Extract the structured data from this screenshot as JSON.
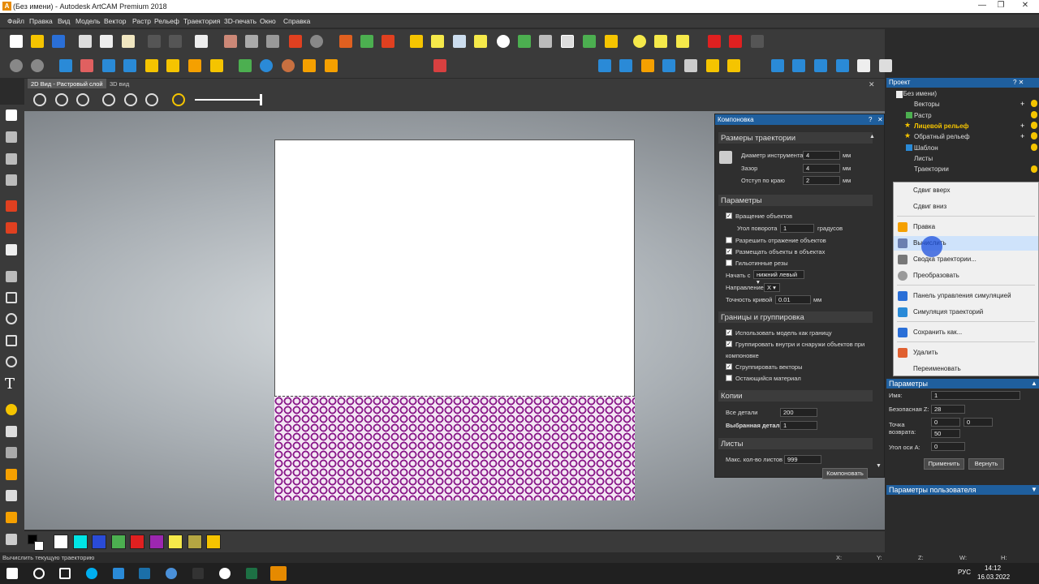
{
  "window": {
    "title": "(Без имени) - Autodesk ArtCAM Premium 2018",
    "logo": "A",
    "minimize": "—",
    "maximize": "❐",
    "close": "✕"
  },
  "menu": [
    "Файл",
    "Правка",
    "Вид",
    "Модель",
    "Вектор",
    "Растр",
    "Рельеф",
    "Траектория",
    "3D-печать",
    "Окно",
    "Справка"
  ],
  "tabs": {
    "tab2d": "2D Вид - Растровый слой",
    "tab3d": "3D вид"
  },
  "layout": {
    "title": "Компоновка",
    "help": "?",
    "close": "✕",
    "sec_sizes": "Размеры траектории",
    "tool_diam_label": "Диаметр инструмента",
    "tool_diam": "4",
    "unit_mm": "мм",
    "gap_label": "Зазор",
    "gap": "4",
    "edge_label": "Отступ по краю",
    "edge": "2",
    "sec_params": "Параметры",
    "rotate_label": "Вращение объектов",
    "angle_label": "Угол поворота",
    "angle": "1",
    "angle_unit": "градусов",
    "mirror_label": "Разрешить отражение объектов",
    "inside_label": "Размещать объекты в объектах",
    "guillotine_label": "Гильотинные резы",
    "start_label": "Начать с",
    "start": "нижний левый",
    "dir_label": "Направление",
    "dir": "X",
    "precision_label": "Точность кривой",
    "precision": "0.01",
    "sec_bounds": "Границы и группировка",
    "use_model_label": "Использовать модель как границу",
    "group_label": "Группировать внутри и снаружи объектов при",
    "group_label2": "компоновке",
    "group_vec_label": "Сгруппировать векторы",
    "remain_label": "Остающийся материал",
    "sec_copies": "Копии",
    "all_parts_label": "Все детали",
    "all_parts": "200",
    "sel_part_label": "Выбранная деталь",
    "sel_part": "1",
    "sec_sheets": "Листы",
    "max_sheets_label": "Макс. кол-во листов",
    "max_sheets": "999",
    "compose_btn": "Компоновать"
  },
  "project": {
    "title": "Проект",
    "help": "? ✕",
    "items": [
      "(Без имени)",
      "Векторы",
      "Растр",
      "Лицевой рельеф",
      "Обратный рельеф",
      "Шаблон",
      "Листы",
      "Траектории"
    ]
  },
  "context_menu": [
    "Сдвиг вверх",
    "Сдвиг вниз",
    "Правка",
    "Вычислить",
    "Сводка траектории...",
    "Преобразовать",
    "Панель управления симуляцией",
    "Симуляция траекторий",
    "Сохранить как...",
    "Удалить",
    "Переименовать"
  ],
  "params": {
    "title": "Параметры",
    "name_label": "Имя:",
    "name": "1",
    "safez_label": "Безопасная Z:",
    "safez": "28",
    "return_label1": "Точка",
    "return_label2": "возврата:",
    "rx": "0",
    "ry": "0",
    "rz": "50",
    "angle_label": "Угол оси A:",
    "angle": "0",
    "apply": "Применить",
    "revert": "Вернуть",
    "user_params": "Параметры пользователя"
  },
  "colors": {
    "accent": "#1f5f9e",
    "pattern": "#8a1a8a"
  },
  "palette": [
    "#000000",
    "#ffffff",
    "#00e5e5",
    "#2a4bd7",
    "#4caf50",
    "#e02020",
    "#9c27b0",
    "#f5e94a",
    "#b5a642",
    "#f5c400"
  ],
  "status": {
    "hint": "Вычислить текущую траекторию",
    "x": "X:",
    "y": "Y:",
    "z": "Z:",
    "w": "W:",
    "h": "H:"
  },
  "taskbar": {
    "time": "14:12",
    "date": "16.03.2022",
    "lang": "РУС"
  }
}
